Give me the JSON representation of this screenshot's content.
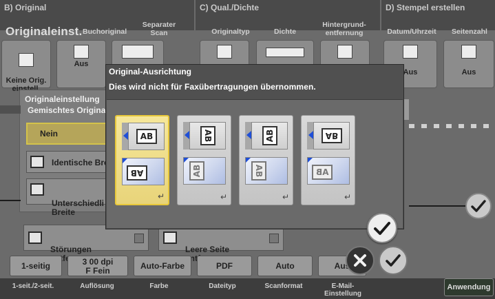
{
  "header": {
    "section_b": "B)  Original",
    "section_c": "C)  Qual./Dichte",
    "section_d": "D)  Stempel erstellen",
    "b_title": "Originaleinst.",
    "b_cols": [
      "Buchoriginal",
      "Separater\nScan"
    ],
    "c_cols": [
      "Originaltyp",
      "Dichte",
      "Hintergrund-\nentfernung"
    ],
    "d_cols": [
      "Datum/Uhrzeit",
      "Seitenzahl"
    ]
  },
  "background": {
    "keine_orig_label": "Keine Orig.\neinstell.",
    "aus_partial": "Aus",
    "aus_d1": "Aus",
    "aus_d2": "Aus",
    "panel_title": "Originaleinstellung",
    "panel_sub": "Gemischtes Origina",
    "nein": "Nein",
    "identische": "Identische Bre",
    "unterschiedliche": "Unterschiedli\nBreite",
    "stoerungen": "Störungen\nentfernen",
    "leere_seite": "Leere Seite\nentfernen"
  },
  "values": [
    "1-seitig",
    "F Fein",
    "Auto-Farbe",
    "PDF",
    "Auto",
    "Aus"
  ],
  "values_partial": "3 00 dpi",
  "bottom_labels": [
    "1-seit./2-seit.",
    "Auflösung",
    "Farbe",
    "Dateityp",
    "Scanformat",
    "E-Mail-\nEinstellung"
  ],
  "apply_button": "Anwendung",
  "dialog": {
    "title": "Original-Ausrichtung",
    "message": "Dies wird nicht für Faxübertragungen übernommen.",
    "options": [
      {
        "top_glyph": "AB",
        "bottom_glyph": "BA",
        "selected": true
      },
      {
        "top_glyph": "AB",
        "bottom_glyph": "AB",
        "selected": false
      },
      {
        "top_glyph": "AB",
        "bottom_glyph": "AB",
        "selected": false
      },
      {
        "top_glyph": "AB",
        "bottom_glyph": "AB",
        "selected": false
      }
    ]
  },
  "colors": {
    "selected_fill": "#f6e79a",
    "selected_border": "#e8c83a",
    "accent_blue": "#1f4fd8",
    "ok_button": "#e9e9e9",
    "cancel_button": "#3a3a3a"
  },
  "icons": {
    "ok": "check-icon",
    "cancel": "close-icon",
    "enter": "return-arrow-icon"
  }
}
